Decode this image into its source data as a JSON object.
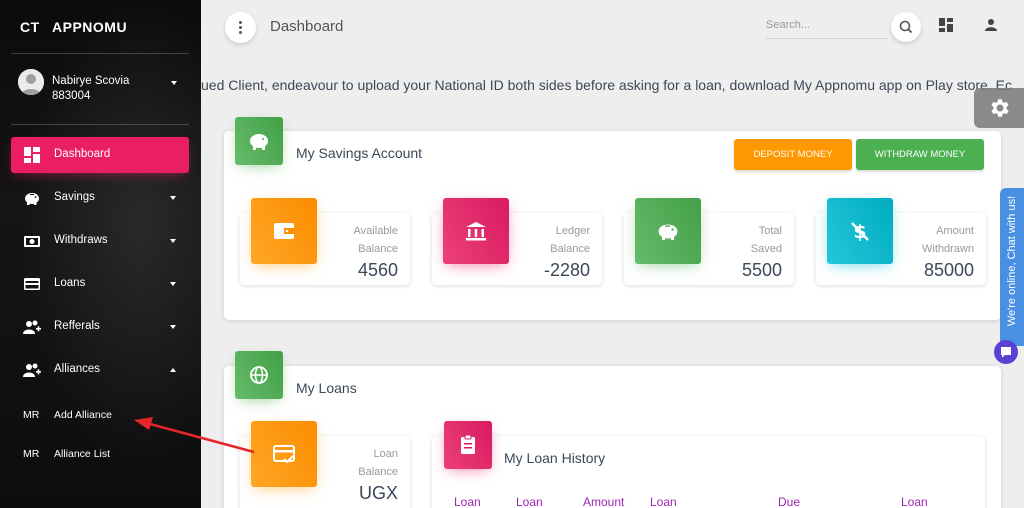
{
  "brand": {
    "mini": "CT",
    "name": "APPNOMU"
  },
  "user": {
    "name": "Nabirye Scovia",
    "id": "883004"
  },
  "sidebar": {
    "items": [
      {
        "label": "Dashboard",
        "icon": "dashboard-icon"
      },
      {
        "label": "Savings",
        "icon": "piggy-bank-icon"
      },
      {
        "label": "Withdraws",
        "icon": "money-icon"
      },
      {
        "label": "Loans",
        "icon": "credit-card-icon"
      },
      {
        "label": "Refferals",
        "icon": "group-add-icon"
      },
      {
        "label": "Alliances",
        "icon": "group-add-icon"
      }
    ],
    "subitems": [
      {
        "mini": "MR",
        "label": "Add Alliance"
      },
      {
        "mini": "MR",
        "label": "Alliance List"
      }
    ]
  },
  "header": {
    "title": "Dashboard",
    "search_placeholder": "Search..."
  },
  "notice": "ued Client, endeavour to upload your National ID both sides before asking for a loan, download My Appnomu app on Play store. Ec",
  "savings": {
    "title": "My Savings Account",
    "deposit_label": "DEPOSIT MONEY",
    "withdraw_label": "WITHDRAW MONEY",
    "stats": [
      {
        "line1": "Available",
        "line2": "Balance",
        "value": "4560",
        "color": "orange",
        "icon": "wallet-icon"
      },
      {
        "line1": "Ledger",
        "line2": "Balance",
        "value": "-2280",
        "color": "pink",
        "icon": "bank-icon"
      },
      {
        "line1": "Total",
        "line2": "Saved",
        "value": "5500",
        "color": "green",
        "icon": "piggy-bank-icon"
      },
      {
        "line1": "Amount",
        "line2": "Withdrawn",
        "value": "85000",
        "color": "cyan",
        "icon": "money-off-icon"
      }
    ]
  },
  "loans": {
    "title": "My Loans",
    "balance": {
      "line1": "Loan",
      "line2": "Balance",
      "value": "UGX"
    },
    "history_title": "My Loan History",
    "history_headers": [
      "Loan",
      "Loan",
      "Amount",
      "Loan",
      "Due",
      "Loan"
    ]
  },
  "chat": {
    "label": "We're online, Chat with us!"
  },
  "colors": {
    "accent": "#e91e63",
    "green": "#4caf50",
    "orange": "#ff9800",
    "cyan": "#00acc1",
    "arrow": "#e5252a"
  }
}
